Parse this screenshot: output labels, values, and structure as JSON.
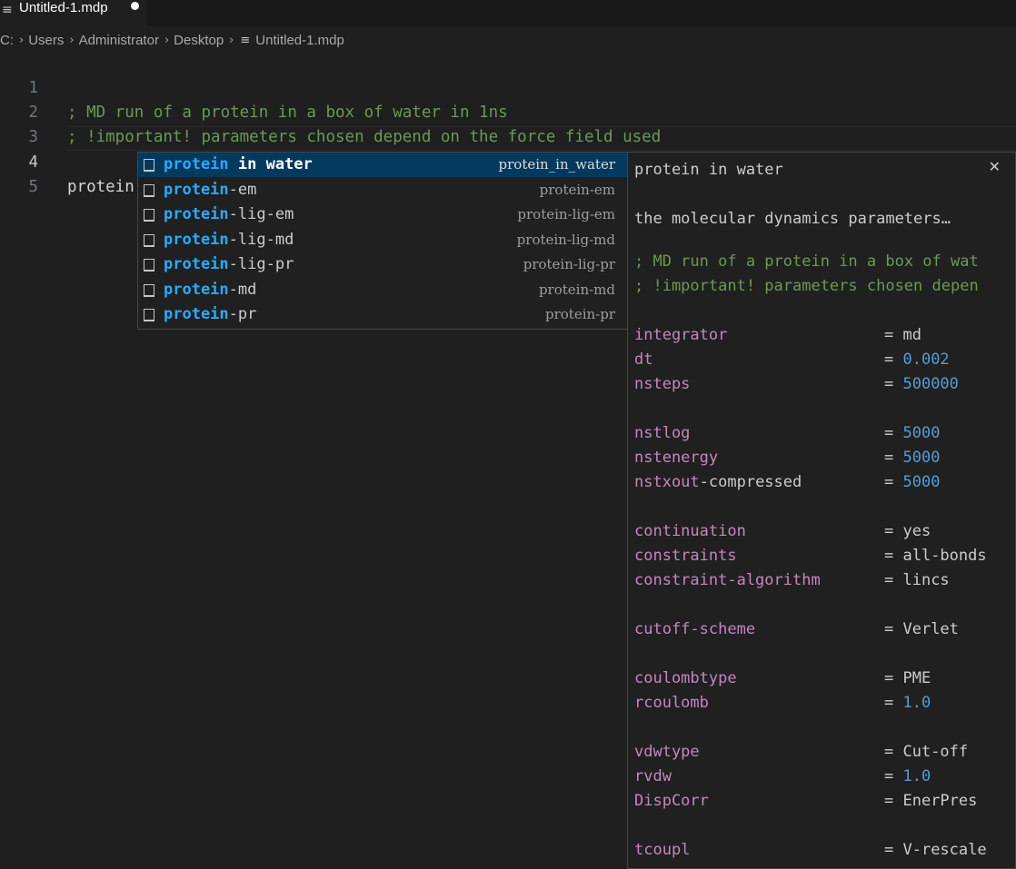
{
  "tab": {
    "title": "Untitled-1.mdp",
    "icon": "file-lines-icon",
    "modified": true
  },
  "breadcrumb": {
    "items": [
      "C:",
      "Users",
      "Administrator",
      "Desktop"
    ],
    "file": "Untitled-1.mdp"
  },
  "editor": {
    "lines": [
      {
        "num": "1",
        "text": "; MD run of a protein in a box of water in 1ns"
      },
      {
        "num": "2",
        "text": "; !important! parameters chosen depend on the force field used"
      },
      {
        "num": "3",
        "text": ""
      },
      {
        "num": "4",
        "text": "protein"
      },
      {
        "num": "5",
        "text": ""
      }
    ]
  },
  "suggest": {
    "items": [
      {
        "match": "protein",
        "rest": " in water",
        "detail": "protein_in_water"
      },
      {
        "match": "protein",
        "rest": "-em",
        "detail": "protein-em"
      },
      {
        "match": "protein",
        "rest": "-lig-em",
        "detail": "protein-lig-em"
      },
      {
        "match": "protein",
        "rest": "-lig-md",
        "detail": "protein-lig-md"
      },
      {
        "match": "protein",
        "rest": "-lig-pr",
        "detail": "protein-lig-pr"
      },
      {
        "match": "protein",
        "rest": "-md",
        "detail": "protein-md"
      },
      {
        "match": "protein",
        "rest": "-pr",
        "detail": "protein-pr"
      }
    ]
  },
  "details": {
    "title": "protein in water",
    "close_icon": "close-icon",
    "description": "the molecular dynamics parameters…",
    "comment1": "; MD run of a protein in a box of wat",
    "comment2": "; !important! parameters chosen depen",
    "params": [
      {
        "key": "integrator",
        "value": "md",
        "type": "str"
      },
      {
        "key": "dt",
        "value": "0.002",
        "type": "num"
      },
      {
        "key": "nsteps",
        "value": "500000",
        "type": "num"
      },
      {
        "key": "nstlog",
        "value": "5000",
        "type": "num"
      },
      {
        "key": "nstenergy",
        "value": "5000",
        "type": "num"
      },
      {
        "key_a": "nstxout",
        "key_b": "-compressed",
        "value": "5000",
        "type": "num"
      },
      {
        "key": "continuation",
        "value": "yes",
        "type": "str"
      },
      {
        "key": "constraints",
        "value": "all-bonds",
        "type": "str"
      },
      {
        "key": "constraint-algorithm",
        "value": "lincs",
        "type": "str"
      },
      {
        "key": "cutoff-scheme",
        "value": "Verlet",
        "type": "str"
      },
      {
        "key": "coulombtype",
        "value": "PME",
        "type": "str"
      },
      {
        "key": "rcoulomb",
        "value": "1.0",
        "type": "num"
      },
      {
        "key": "vdwtype",
        "value": "Cut-off",
        "type": "str"
      },
      {
        "key": "rvdw",
        "value": "1.0",
        "type": "num"
      },
      {
        "key": "DispCorr",
        "value": "EnerPres",
        "type": "str"
      },
      {
        "key": "tcoupl",
        "value": "V-rescale",
        "type": "str"
      }
    ]
  }
}
